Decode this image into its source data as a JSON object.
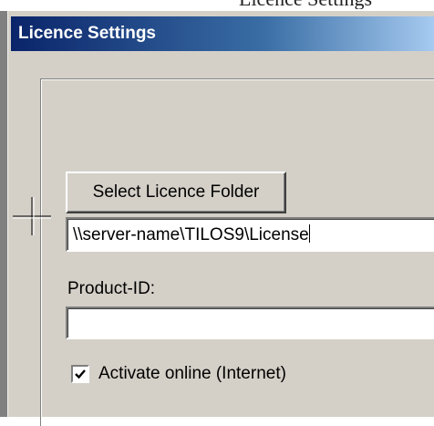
{
  "page_title_fragment": "Licence Settings",
  "window": {
    "title": "Licence Settings"
  },
  "licence_folder": {
    "button_label": "Select Licence Folder",
    "path_value": "\\\\server-name\\TILOS9\\License"
  },
  "product_id": {
    "label": "Product-ID:",
    "value": ""
  },
  "activate_online": {
    "label": "Activate online (Internet)",
    "checked": true
  },
  "icons": {
    "cursor": "crosshair-cursor-icon",
    "checkmark": "checkmark-icon"
  },
  "colors": {
    "titlebar_start": "#0a246a",
    "titlebar_end": "#a6caf0",
    "dialog_face": "#d4d0c8"
  }
}
